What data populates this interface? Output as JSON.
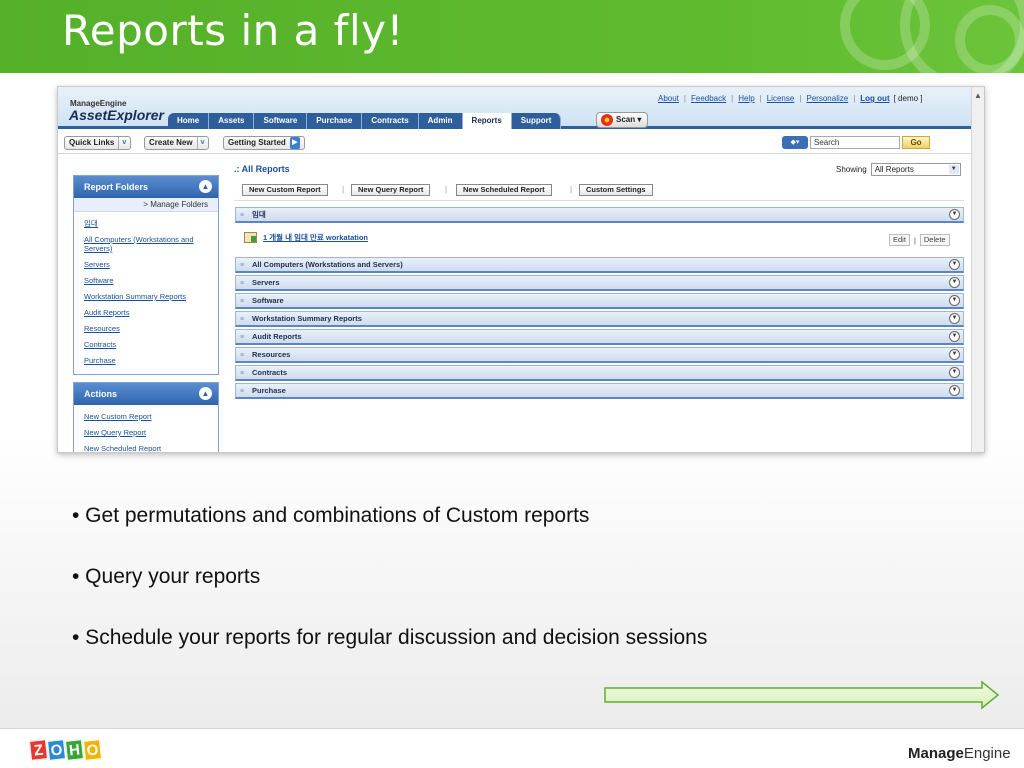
{
  "slide": {
    "title": "Reports in a fly!",
    "bullets": [
      "• Get permutations and combinations of Custom reports",
      "• Query your reports",
      "• Schedule your reports for regular discussion and decision sessions"
    ],
    "footer_logo_left": [
      "Z",
      "O",
      "H",
      "O"
    ],
    "footer_logo_right_bold": "Manage",
    "footer_logo_right_rest": "Engine"
  },
  "app": {
    "brand_line1": "ManageEngine",
    "brand_line2": "AssetExplorer",
    "top_links": {
      "about": "About",
      "feedback": "Feedback",
      "help": "Help",
      "license": "License",
      "personalize": "Personalize",
      "logout": "Log out",
      "user": "[ demo ]"
    },
    "nav_tabs": [
      "Home",
      "Assets",
      "Software",
      "Purchase",
      "Contracts",
      "Admin",
      "Reports",
      "Support"
    ],
    "active_tab": "Reports",
    "scan_label": "Scan ▾",
    "toolbar": {
      "quick_links": "Quick Links",
      "create_new": "Create New",
      "getting_started": "Getting Started",
      "search_placeholder": "Search",
      "go": "Go",
      "caret": "v"
    },
    "sidebar": {
      "report_folders_title": "Report Folders",
      "manage_folders": "> Manage Folders",
      "folders": [
        "임대",
        "All Computers (Workstations and Servers)",
        "Servers",
        "Software",
        "Workstation Summary Reports",
        "Audit Reports",
        "Resources",
        "Contracts",
        "Purchase"
      ],
      "actions_title": "Actions",
      "actions": [
        "New Custom Report",
        "New Query Report",
        "New Scheduled Report"
      ]
    },
    "main": {
      "breadcrumb": ".: All Reports",
      "showing_label": "Showing",
      "showing_value": "All Reports",
      "buttons": [
        "New Custom Report",
        "New Query Report",
        "New Scheduled Report",
        "Custom Settings"
      ],
      "first_folder": "임대",
      "report_item": "1 개월 내 임대 만료 workatation",
      "edit": "Edit",
      "delete": "Delete",
      "separator": "|",
      "folders": [
        "All Computers (Workstations and Servers)",
        "Servers",
        "Software",
        "Workstation Summary Reports",
        "Audit Reports",
        "Resources",
        "Contracts",
        "Purchase"
      ]
    }
  }
}
